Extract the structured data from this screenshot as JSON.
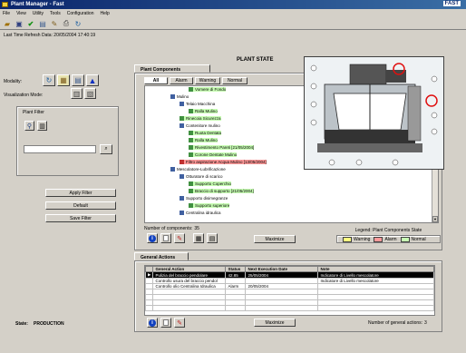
{
  "window": {
    "title": "Plant Manager - Fast",
    "brand": "FAST"
  },
  "menu": [
    "File",
    "View",
    "Utility",
    "Tools",
    "Configuration",
    "Help"
  ],
  "toolbar_icons": [
    "open-icon",
    "save-icon",
    "check-icon",
    "document-icon",
    "edit-icon",
    "print-icon",
    "refresh-icon"
  ],
  "refresh_info": "Last Time Refresh Data: 20/05/2004 17:40:19",
  "page_title": "PLANT STATE",
  "left": {
    "modality_label": "Modality:",
    "visualization_label": "Visualization Mode:",
    "plant_filter_label": "Plant Filter",
    "apply_filter": "Apply Filter",
    "default": "Default",
    "save_filter": "Save Filter",
    "filter_value": "",
    "state_label": "State:",
    "state_value": "PRODUCTION"
  },
  "plant_components": {
    "tab_label": "Plant Components",
    "subtabs": [
      "All",
      "Alarm",
      "Warning",
      "Normal"
    ],
    "tree": [
      {
        "label": "Vomere di Fondo",
        "status": "normal"
      },
      {
        "label": "Mulino",
        "status": "none"
      },
      {
        "label": "Telaio Macchina",
        "status": "none"
      },
      {
        "label": "Ralla Mulino",
        "status": "normal"
      },
      {
        "label": "Rinecoia Sicurezza",
        "status": "normal"
      },
      {
        "label": "Contenitore mulino",
        "status": "none"
      },
      {
        "label": "Ruota Dentata",
        "status": "normal"
      },
      {
        "label": "Ralla Mulino",
        "status": "normal"
      },
      {
        "label": "Rivestimento Pareti [21/05/2004]",
        "status": "normal"
      },
      {
        "label": "Corone Dentate Mulino",
        "status": "normal"
      },
      {
        "label": "Filtro aspirazione Acqua Mulino [13/05/2004]",
        "status": "alarm"
      },
      {
        "label": "Mescolatore-Lubrificazione",
        "status": "none"
      },
      {
        "label": "Otturatore di scarico",
        "status": "none"
      },
      {
        "label": "Supporto Coperchio",
        "status": "normal"
      },
      {
        "label": "Braccio di supporto [21/05/2004]",
        "status": "normal"
      },
      {
        "label": "Supporto disimegranze",
        "status": "none"
      },
      {
        "label": "Supporto superiore",
        "status": "normal"
      },
      {
        "label": "Centralina idraulica",
        "status": "none"
      }
    ],
    "count_label": "Number of components:",
    "count_value": "35",
    "maximize": "Maximize",
    "legend_title": "Legend: Plant Components State",
    "legend": [
      {
        "label": "Warning",
        "color": "#ffff80"
      },
      {
        "label": "Alarm",
        "color": "#ff9a9a"
      },
      {
        "label": "Normal",
        "color": "#c8ffb4"
      }
    ]
  },
  "general_actions": {
    "tab_label": "General Actions",
    "columns": [
      "General Action",
      "Status",
      "Next Execution Date",
      "Note"
    ],
    "rows": [
      [
        "Pulizia del braccio pendolare",
        "42.85",
        "25/05/2004",
        "Indicatore di Livello mescolatore"
      ],
      [
        "Controllo usura del braccio pendol",
        "",
        "",
        "Indicatore di Livello mescolatore"
      ],
      [
        "Controllo olio Centralina Idraulica",
        "Alarm",
        "20/05/2004",
        ""
      ],
      [
        "",
        "",
        "",
        ""
      ],
      [
        "",
        "",
        "",
        ""
      ],
      [
        "",
        "",
        "",
        ""
      ],
      [
        "",
        "",
        "",
        ""
      ]
    ],
    "maximize": "Maximize",
    "count_label": "Number of general actions:",
    "count_value": "3"
  },
  "colors": {
    "alarm": "#ff9a9a",
    "normal": "#c8ffb4",
    "warning": "#ffff80",
    "highlight_circle": "#e01010"
  }
}
